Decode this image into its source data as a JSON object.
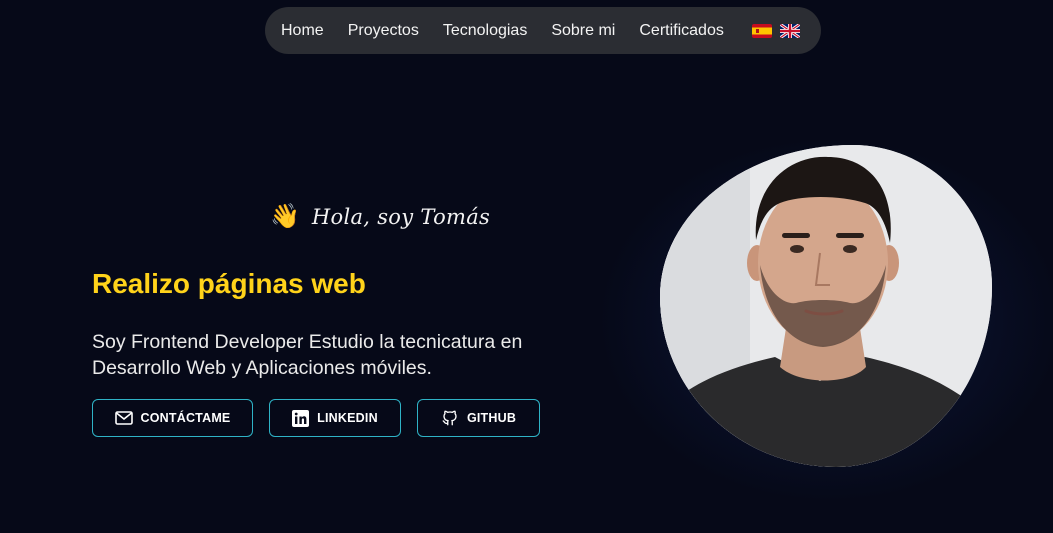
{
  "nav": {
    "links": [
      "Home",
      "Proyectos",
      "Tecnologias",
      "Sobre mi",
      "Certificados"
    ],
    "flags": [
      "spain-flag-icon",
      "uk-flag-icon"
    ]
  },
  "hero": {
    "wave_emoji": "👋",
    "greeting": "Hola, soy Tomás",
    "headline": "Realizo páginas web",
    "description": "Soy Frontend Developer Estudio la tecnicatura en Desarrollo Web y Aplicaciones móviles.",
    "buttons": {
      "contact": "CONTÁCTAME",
      "linkedin": "LINKEDIN",
      "github": "GITHUB"
    }
  },
  "colors": {
    "background": "#060918",
    "nav_background": "#2b2d33",
    "headline": "#ffd31a",
    "button_border": "#2fb3c6"
  }
}
